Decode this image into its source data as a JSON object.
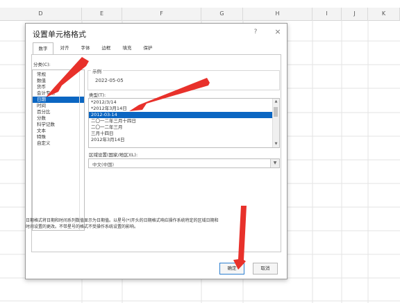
{
  "columns": [
    "D",
    "E",
    "F",
    "G",
    "H",
    "I",
    "J",
    "K"
  ],
  "dialog": {
    "title": "设置单元格格式",
    "help": "?",
    "close": "×",
    "tabs": [
      "数字",
      "对齐",
      "字体",
      "边框",
      "填充",
      "保护"
    ],
    "active_tab": "数字",
    "category_label": "分类(C):",
    "categories": [
      "常规",
      "数值",
      "货币",
      "会计专用",
      "日期",
      "时间",
      "百分比",
      "分数",
      "科学记数",
      "文本",
      "特殊",
      "自定义"
    ],
    "selected_category": "日期",
    "sample_label": "示例",
    "sample_value": "2022-05-05",
    "type_label": "类型(T):",
    "types": [
      "*2012/3/14",
      "*2012年3月14日",
      "2012-03-14",
      "二〇一二年三月十四日",
      "二〇一二年三月",
      "三月十四日",
      "2012年3月14日"
    ],
    "selected_type": "2012-03-14",
    "locale_label": "区域设置(国家/地区)(L):",
    "locale_value": "中文(中国)",
    "description_line1": "日期格式将日期和时间系列数值显示为日期值。以星号(*)开头的日期格式响应操作系统特定的区域日期和",
    "description_line2": "时间设置的更改。不带星号的格式不受操作系统设置的影响。",
    "ok": "确定",
    "cancel": "取消"
  },
  "annotation_color": "#e8312b",
  "accent_color": "#0b66c2"
}
